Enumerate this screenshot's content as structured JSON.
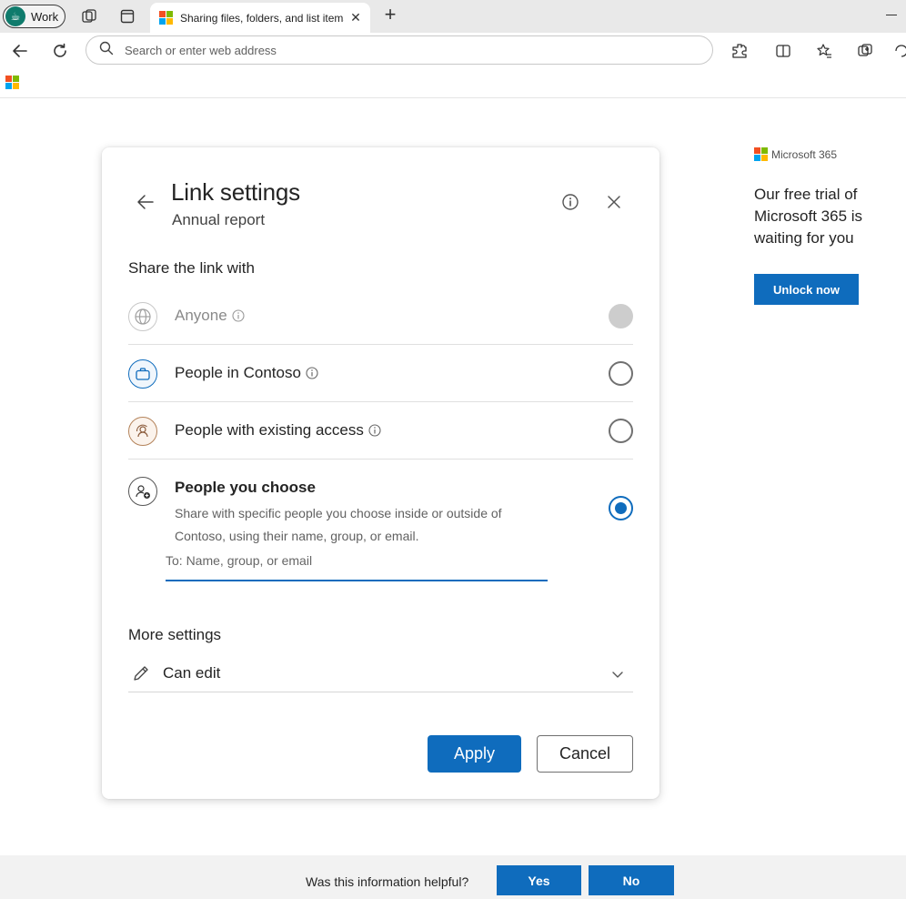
{
  "browser": {
    "profile_label": "Work",
    "tab_title": "Sharing files, folders, and list items",
    "address_placeholder": "Search or enter web address"
  },
  "dialog": {
    "title": "Link settings",
    "subtitle": "Annual report",
    "share_heading": "Share the link with",
    "options": [
      {
        "label": "Anyone",
        "state": "disabled",
        "icon": "globe-icon"
      },
      {
        "label": "People in Contoso",
        "state": "unchecked",
        "icon": "briefcase-icon"
      },
      {
        "label": "People with existing access",
        "state": "unchecked",
        "icon": "person-cycle-icon"
      },
      {
        "label": "People you choose",
        "state": "checked",
        "icon": "person-add-icon"
      }
    ],
    "choose_description": "Share with specific people you choose inside or outside of Contoso, using their name, group, or email.",
    "to_placeholder": "To: Name, group, or email",
    "more_heading": "More settings",
    "permission_value": "Can edit",
    "apply_label": "Apply",
    "cancel_label": "Cancel"
  },
  "promo": {
    "brand": "Microsoft 365",
    "text": "Our free trial of Microsoft 365 is waiting for you",
    "button": "Unlock now"
  },
  "feedback": {
    "question": "Was this information helpful?",
    "yes": "Yes",
    "no": "No"
  },
  "colors": {
    "accent": "#0f6cbd",
    "tabbar": "#e9e9e9",
    "feedback_bg": "#f2f2f2"
  }
}
